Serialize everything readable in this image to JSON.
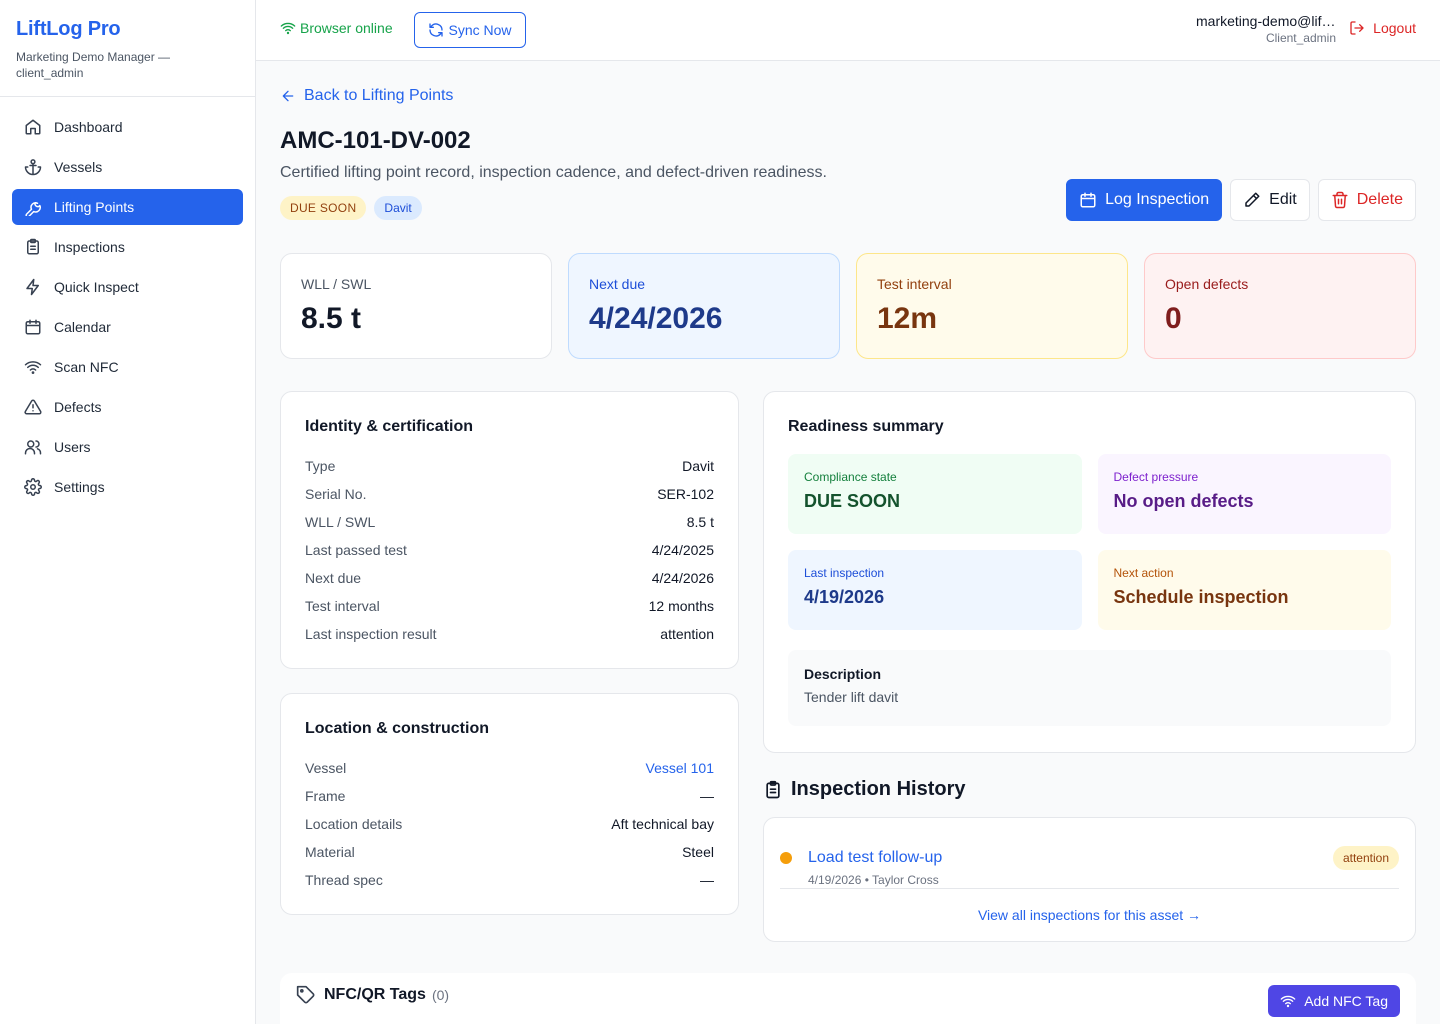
{
  "brand": {
    "title": "LiftLog Pro",
    "subtitle": "Marketing Demo Manager — client_admin"
  },
  "nav": [
    {
      "label": "Dashboard",
      "icon": "home-icon"
    },
    {
      "label": "Vessels",
      "icon": "anchor-icon"
    },
    {
      "label": "Lifting Points",
      "icon": "wrench-icon",
      "active": true
    },
    {
      "label": "Inspections",
      "icon": "clipboard-icon"
    },
    {
      "label": "Quick Inspect",
      "icon": "zap-icon"
    },
    {
      "label": "Calendar",
      "icon": "calendar-icon"
    },
    {
      "label": "Scan NFC",
      "icon": "wifi-icon"
    },
    {
      "label": "Defects",
      "icon": "alert-triangle-icon"
    },
    {
      "label": "Users",
      "icon": "users-icon"
    },
    {
      "label": "Settings",
      "icon": "gear-icon"
    }
  ],
  "topbar": {
    "online": "Browser online",
    "sync": "Sync Now",
    "user_email": "marketing-demo@liftlog.pro",
    "user_role": "Client_admin",
    "logout": "Logout"
  },
  "page": {
    "back": "Back to Lifting Points",
    "title": "AMC-101-DV-002",
    "subtitle": "Certified lifting point record, inspection cadence, and defect-driven readiness.",
    "badge_status": "DUE SOON",
    "badge_type": "Davit",
    "actions": {
      "log": "Log Inspection",
      "edit": "Edit",
      "delete": "Delete"
    }
  },
  "stats": [
    {
      "label": "WLL / SWL",
      "value": "8.5 t"
    },
    {
      "label": "Next due",
      "value": "4/24/2026"
    },
    {
      "label": "Test interval",
      "value": "12m"
    },
    {
      "label": "Open defects",
      "value": "0"
    }
  ],
  "identity": {
    "title": "Identity & certification",
    "rows": [
      {
        "k": "Type",
        "v": "Davit"
      },
      {
        "k": "Serial No.",
        "v": "SER-102"
      },
      {
        "k": "WLL / SWL",
        "v": "8.5 t"
      },
      {
        "k": "Last passed test",
        "v": "4/24/2025"
      },
      {
        "k": "Next due",
        "v": "4/24/2026"
      },
      {
        "k": "Test interval",
        "v": "12 months"
      },
      {
        "k": "Last inspection result",
        "v": "attention"
      }
    ]
  },
  "location": {
    "title": "Location & construction",
    "rows": [
      {
        "k": "Vessel",
        "v": "Vessel 101"
      },
      {
        "k": "Frame",
        "v": "—"
      },
      {
        "k": "Location details",
        "v": "Aft technical bay"
      },
      {
        "k": "Material",
        "v": "Steel"
      },
      {
        "k": "Thread spec",
        "v": "—"
      }
    ]
  },
  "readiness": {
    "title": "Readiness summary",
    "tiles": [
      {
        "label": "Compliance state",
        "value": "DUE SOON"
      },
      {
        "label": "Defect pressure",
        "value": "No open defects"
      },
      {
        "label": "Last inspection",
        "value": "4/19/2026"
      },
      {
        "label": "Next action",
        "value": "Schedule inspection"
      }
    ],
    "description_title": "Description",
    "description": "Tender lift davit"
  },
  "history": {
    "title": "Inspection History",
    "items": [
      {
        "title": "Load test follow-up",
        "meta": "4/19/2026 • Taylor Cross",
        "badge": "attention"
      }
    ],
    "view_all": "View all inspections for this asset →"
  },
  "nfc": {
    "title": "NFC/QR Tags",
    "count": "(0)",
    "add": "Add NFC Tag"
  },
  "colors": {
    "accent": "#2563eb",
    "danger": "#dc2626",
    "success": "#16a34a",
    "nfc": "#4f46e5"
  }
}
